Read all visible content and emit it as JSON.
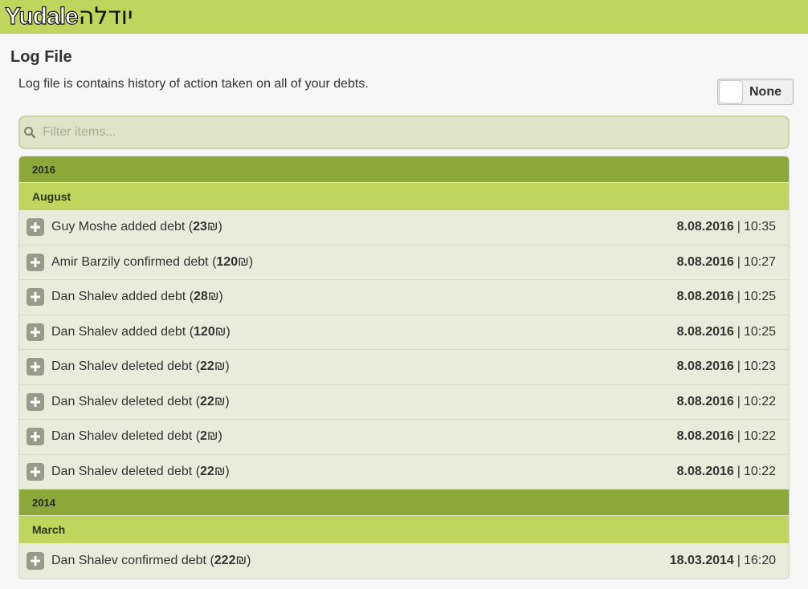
{
  "header": {
    "logo_text_en": "Yudale",
    "logo_text_he": "יודלה"
  },
  "page": {
    "title": "Log File",
    "description": "Log file is contains history of action taken on all of your debts."
  },
  "toggle": {
    "label": "None",
    "state": "off"
  },
  "filter": {
    "placeholder": "Filter items..."
  },
  "currency_symbol": "₪",
  "groups": [
    {
      "year": "2016",
      "months": [
        {
          "month": "August",
          "entries": [
            {
              "text": "Guy Moshe added debt (",
              "amount": "23",
              "date": "8.08.2016",
              "time": "10:35"
            },
            {
              "text": "Amir Barzily confirmed debt (",
              "amount": "120",
              "date": "8.08.2016",
              "time": "10:27"
            },
            {
              "text": "Dan Shalev added debt (",
              "amount": "28",
              "date": "8.08.2016",
              "time": "10:25"
            },
            {
              "text": "Dan Shalev added debt (",
              "amount": "120",
              "date": "8.08.2016",
              "time": "10:25"
            },
            {
              "text": "Dan Shalev deleted debt (",
              "amount": "22",
              "date": "8.08.2016",
              "time": "10:23"
            },
            {
              "text": "Dan Shalev deleted debt (",
              "amount": "22",
              "date": "8.08.2016",
              "time": "10:22"
            },
            {
              "text": "Dan Shalev deleted debt (",
              "amount": "2",
              "date": "8.08.2016",
              "time": "10:22"
            },
            {
              "text": "Dan Shalev deleted debt (",
              "amount": "22",
              "date": "8.08.2016",
              "time": "10:22"
            }
          ]
        }
      ]
    },
    {
      "year": "2014",
      "months": [
        {
          "month": "March",
          "entries": [
            {
              "text": "Dan Shalev confirmed debt (",
              "amount": "222",
              "date": "18.03.2014",
              "time": "16:20"
            }
          ]
        }
      ]
    }
  ],
  "icons": {
    "filter": "search-icon",
    "expand": "plus-icon"
  },
  "colors": {
    "topbar": "#c0d55d",
    "year_header": "#8ca83a",
    "month_header": "#c0d55d",
    "row_bg": "#e9ecda"
  }
}
